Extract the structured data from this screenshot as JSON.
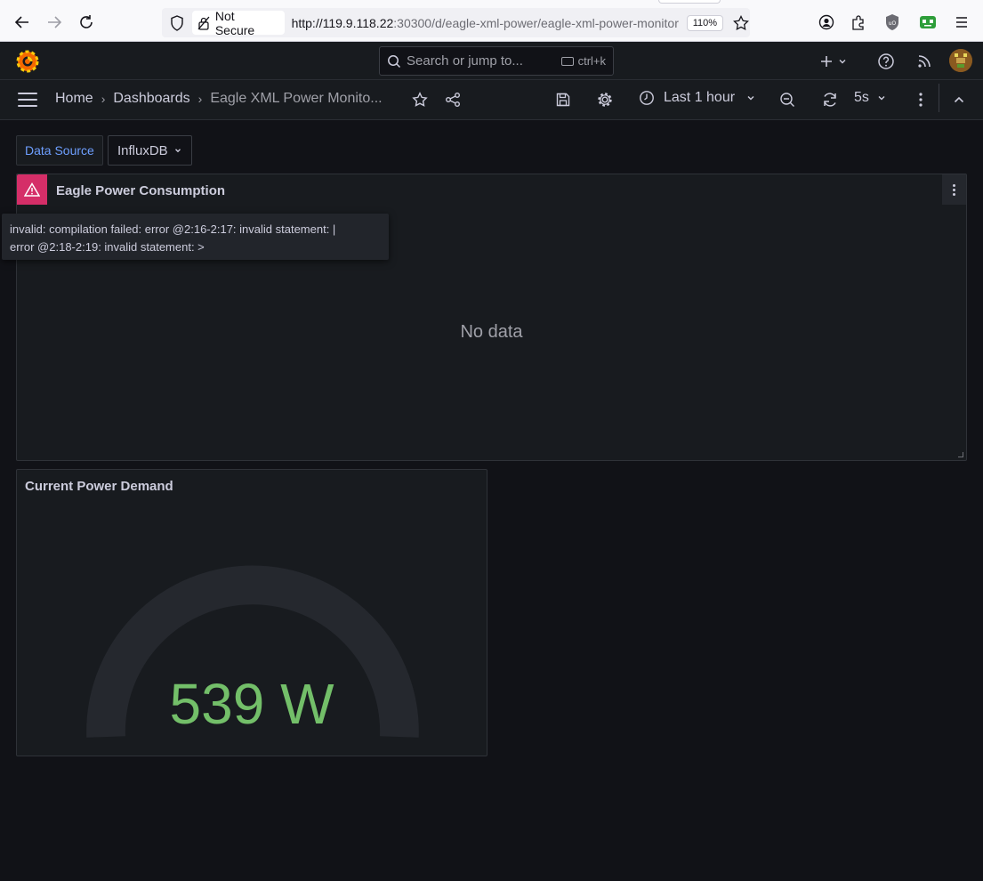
{
  "browser": {
    "security_label": "Not Secure",
    "url_host": "http://119.9.118.22",
    "url_rest": ":30300/d/eagle-xml-power/eagle-xml-power-monitor",
    "zoom": "110%",
    "icons": [
      "back-icon",
      "forward-icon",
      "reload-icon",
      "shield-icon",
      "lock-icon",
      "bookmark-star-icon",
      "account-icon",
      "extensions-icon",
      "ublock-icon",
      "extension-robot-icon",
      "menu-icon"
    ]
  },
  "topbar": {
    "search_placeholder": "Search or jump to...",
    "search_shortcut": "ctrl+k"
  },
  "navbar": {
    "breadcrumbs": [
      "Home",
      "Dashboards",
      "Eagle XML Power Monito..."
    ],
    "time_range": "Last 1 hour",
    "refresh_interval": "5s"
  },
  "variables": {
    "label": "Data Source",
    "value": "InfluxDB"
  },
  "panels": {
    "consumption": {
      "title": "Eagle Power Consumption",
      "error_line1": "invalid: compilation failed: error @2:16-2:17: invalid statement: |",
      "error_line2": "error @2:18-2:19: invalid statement: >",
      "no_data": "No data"
    },
    "demand": {
      "title": "Current Power Demand",
      "value": "539 W",
      "value_color": "#73bf69"
    }
  },
  "colors": {
    "background": "#111217",
    "panel": "#181b1f",
    "error": "#d52e68",
    "accent_link": "#6e9fff"
  }
}
